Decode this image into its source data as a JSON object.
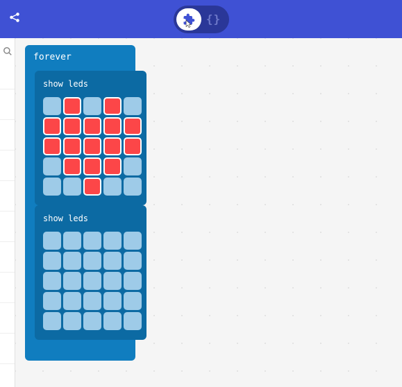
{
  "topbar": {
    "share_icon": "share-icon",
    "blocks_icon": "puzzle-icon",
    "code_glyph": "{}"
  },
  "sidebar": {
    "search_icon": "search-icon"
  },
  "blocks": {
    "forever": {
      "label": "forever"
    },
    "showleds1": {
      "label": "show leds",
      "grid": [
        [
          0,
          1,
          0,
          1,
          0
        ],
        [
          1,
          1,
          1,
          1,
          1
        ],
        [
          1,
          1,
          1,
          1,
          1
        ],
        [
          0,
          1,
          1,
          1,
          0
        ],
        [
          0,
          0,
          1,
          0,
          0
        ]
      ]
    },
    "showleds2": {
      "label": "show leds",
      "grid": [
        [
          0,
          0,
          0,
          0,
          0
        ],
        [
          0,
          0,
          0,
          0,
          0
        ],
        [
          0,
          0,
          0,
          0,
          0
        ],
        [
          0,
          0,
          0,
          0,
          0
        ],
        [
          0,
          0,
          0,
          0,
          0
        ]
      ]
    }
  }
}
